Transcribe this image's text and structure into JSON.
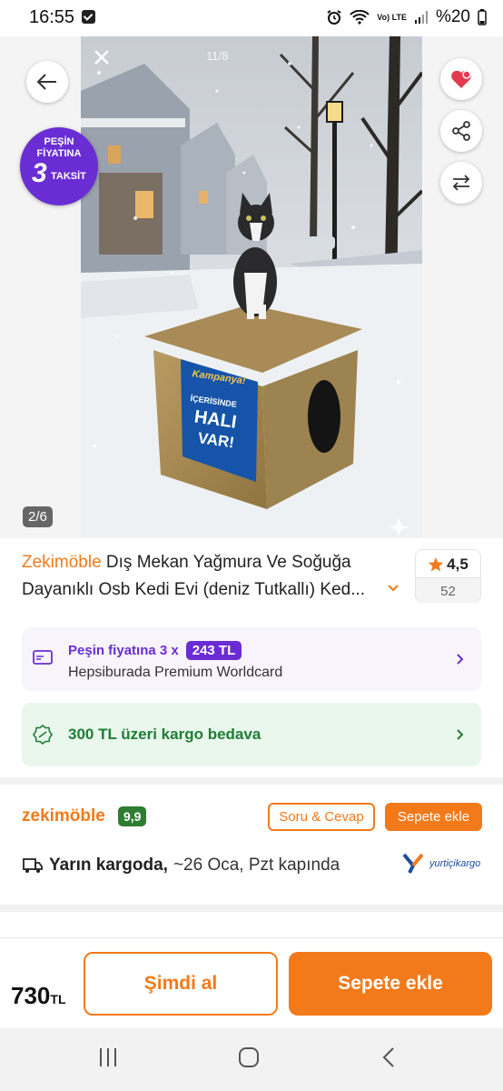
{
  "status_bar": {
    "time": "16:55",
    "battery": "%20",
    "network": "Vo) LTE"
  },
  "gallery": {
    "page_indicator": "2/6",
    "photo_counter": "11/8",
    "badge": {
      "line1": "PEŞİN",
      "line2": "FİYATINA",
      "number": "3",
      "line3": "TAKSİT"
    },
    "sign": {
      "top": "Kampanya!",
      "l1": "İÇERİSİNDE",
      "l2": "HALI",
      "l3": "VAR!"
    }
  },
  "product": {
    "brand": "Zekimöble",
    "title_line1": " Dış Mekan Yağmura Ve Soğuğa",
    "title_line2": "Dayanıklı Osb Kedi Evi (deniz Tutkallı) Ked...",
    "rating": "4,5",
    "rating_count": "52"
  },
  "promo_installment": {
    "label": "Peşin fiyatına 3 x",
    "amount": "243 TL",
    "card": "Hepsiburada Premium Worldcard"
  },
  "promo_shipping": {
    "text": "300 TL üzeri kargo bedava"
  },
  "seller": {
    "name": "zekimöble",
    "score": "9,9",
    "qa_label": "Soru & Cevap",
    "add_cart_label": "Sepete ekle"
  },
  "delivery": {
    "bold": "Yarın kargoda,",
    "rest": "~26 Oca, Pzt kapında",
    "carrier": "yurtiçikargo"
  },
  "bottom": {
    "price": "730",
    "currency": "TL",
    "buy_now": "Şimdi al",
    "add_cart": "Sepete ekle"
  },
  "colors": {
    "accent": "#f27a1a",
    "purple": "#6a2dd4",
    "green": "#1e7d35"
  }
}
